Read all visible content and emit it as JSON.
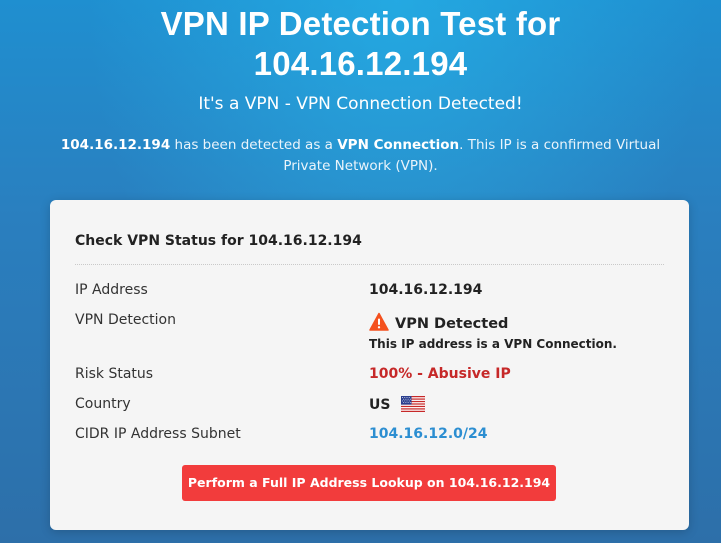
{
  "hero": {
    "title_line1": "VPN IP Detection Test for",
    "title_line2": "104.16.12.194",
    "subtitle": "It's a VPN - VPN Connection Detected!",
    "desc_ip": "104.16.12.194",
    "desc_mid": "has been detected as a",
    "desc_type": "VPN Connection",
    "desc_tail": ". This IP is a confirmed Virtual Private Network (VPN)."
  },
  "card": {
    "title": "Check VPN Status for 104.16.12.194",
    "rows": {
      "ip": {
        "label": "IP Address",
        "value": "104.16.12.194"
      },
      "vpn": {
        "label": "VPN Detection",
        "value": "VPN Detected",
        "sub": "This IP address is a VPN Connection.",
        "icon": "warning-icon"
      },
      "risk": {
        "label": "Risk Status",
        "value": "100% - Abusive IP",
        "color": "#c62828"
      },
      "country": {
        "label": "Country",
        "value": "US",
        "icon": "us-flag-icon"
      },
      "cidr": {
        "label": "CIDR IP Address Subnet",
        "value": "104.16.12.0/24",
        "color": "#2c8ed1"
      }
    },
    "button_label": "Perform a Full IP Address Lookup on 104.16.12.194",
    "button_color": "#f23c3c"
  },
  "colors": {
    "warning_icon": "#f4511e"
  }
}
